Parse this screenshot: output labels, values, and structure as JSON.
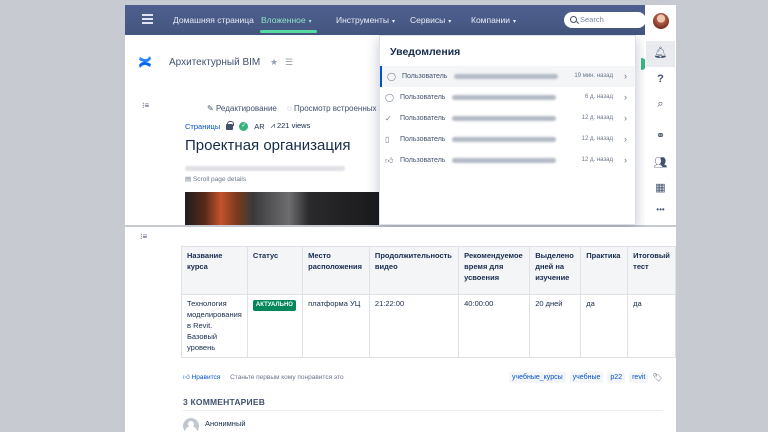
{
  "nav": {
    "items": [
      {
        "label": "Домашняя страница",
        "caret": false
      },
      {
        "label": "Вложенное",
        "caret": true,
        "active": true
      },
      {
        "label": "Инструменты",
        "caret": true
      },
      {
        "label": "Сервисы",
        "caret": true
      },
      {
        "label": "Компании",
        "caret": true
      }
    ],
    "search_placeholder": "Search"
  },
  "space": {
    "title": "Архитектурный BIM"
  },
  "toolbar": {
    "edit_label": "Редактирование",
    "view_label": "Просмотр встроенных"
  },
  "breadcrumb": {
    "pages": "Страницы",
    "ar_label": "AR",
    "views": "221 views"
  },
  "page": {
    "title": "Проектная организация",
    "scroll_details": "Scroll page details"
  },
  "notifications": {
    "title": "Уведомления",
    "items": [
      {
        "icon": "comment",
        "user": "Пользователь",
        "time": "19 мин. назад"
      },
      {
        "icon": "comment",
        "user": "Пользователь",
        "time": "6 д. назад"
      },
      {
        "icon": "check",
        "user": "Пользователь",
        "time": "12 д. назад"
      },
      {
        "icon": "page",
        "user": "Пользователь",
        "time": "12 д. назад"
      },
      {
        "icon": "like",
        "user": "Пользователь",
        "time": "12 д. назад"
      }
    ]
  },
  "sidebar": {
    "help": "?",
    "more": "•••"
  },
  "table": {
    "headers": [
      "Название курса",
      "Статус",
      "Место расположения",
      "Продолжительность видео",
      "Рекомендуемое время для усвоения",
      "Выделено дней на изучение",
      "Практика",
      "Итоговый тест"
    ],
    "row": {
      "course": "Технология моделирования в Revit. Базовый уровень",
      "status": "АКТУАЛЬНО",
      "location": "платформа УЦ",
      "video": "21:22:00",
      "recommended": "40:00:00",
      "days": "20 дней",
      "practice": "да",
      "test": "да"
    }
  },
  "likes": {
    "like_label": "Нравится",
    "prompt": "Станьте первым кому понравится это"
  },
  "labels": [
    "учебные_курсы",
    "учебные",
    "p22",
    "revit"
  ],
  "comments": {
    "heading": "3 КОММЕНТАРИЕВ",
    "first_author": "Анонимный"
  },
  "colors": {
    "nav_bg": "#4a5b89",
    "active_nav": "#57d9a3",
    "link": "#0052cc",
    "status_green": "#00875a"
  }
}
